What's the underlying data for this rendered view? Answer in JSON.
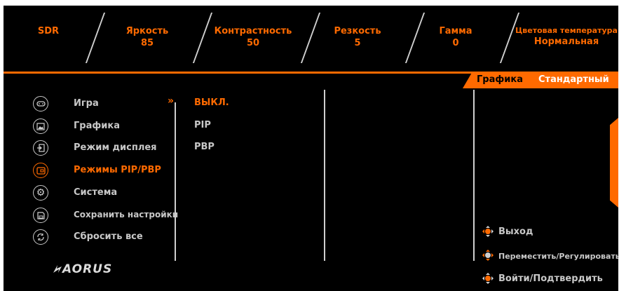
{
  "status_bar": {
    "mode": "SDR",
    "brightness": {
      "label": "Яркость",
      "value": "85"
    },
    "contrast": {
      "label": "Контрастность",
      "value": "50"
    },
    "sharpness": {
      "label": "Резкость",
      "value": "5"
    },
    "gamma": {
      "label": "Гамма",
      "value": "0"
    },
    "color_temp": {
      "label": "Цветовая температура",
      "value": "Нормальная"
    }
  },
  "picture_mode": {
    "label": "Графика",
    "value": "Стандартный"
  },
  "menu": [
    {
      "label": "Игра",
      "icon": "gamepad-icon"
    },
    {
      "label": "Графика",
      "icon": "picture-icon"
    },
    {
      "label": "Режим дисплея",
      "icon": "display-input-icon"
    },
    {
      "label": "Режимы PIP/PBP",
      "icon": "pip-icon",
      "active": true
    },
    {
      "label": "Система",
      "icon": "gear-icon"
    },
    {
      "label": "Сохранить настройки",
      "icon": "save-icon"
    },
    {
      "label": "Сбросить все",
      "icon": "reset-icon"
    }
  ],
  "submenu": [
    {
      "label": "ВЫКЛ.",
      "selected": true
    },
    {
      "label": "PIP"
    },
    {
      "label": "PBP"
    }
  ],
  "hints": [
    {
      "label": "Выход",
      "icon": "joystick-left-icon"
    },
    {
      "label": "Переместить/Регулировать",
      "icon": "joystick-move-icon"
    },
    {
      "label": "Войти/Подтвердить",
      "icon": "joystick-press-icon"
    }
  ],
  "brand": "AORUS",
  "colors": {
    "accent": "#ff6a00",
    "background": "#000000",
    "text": "#c8c8c8"
  }
}
